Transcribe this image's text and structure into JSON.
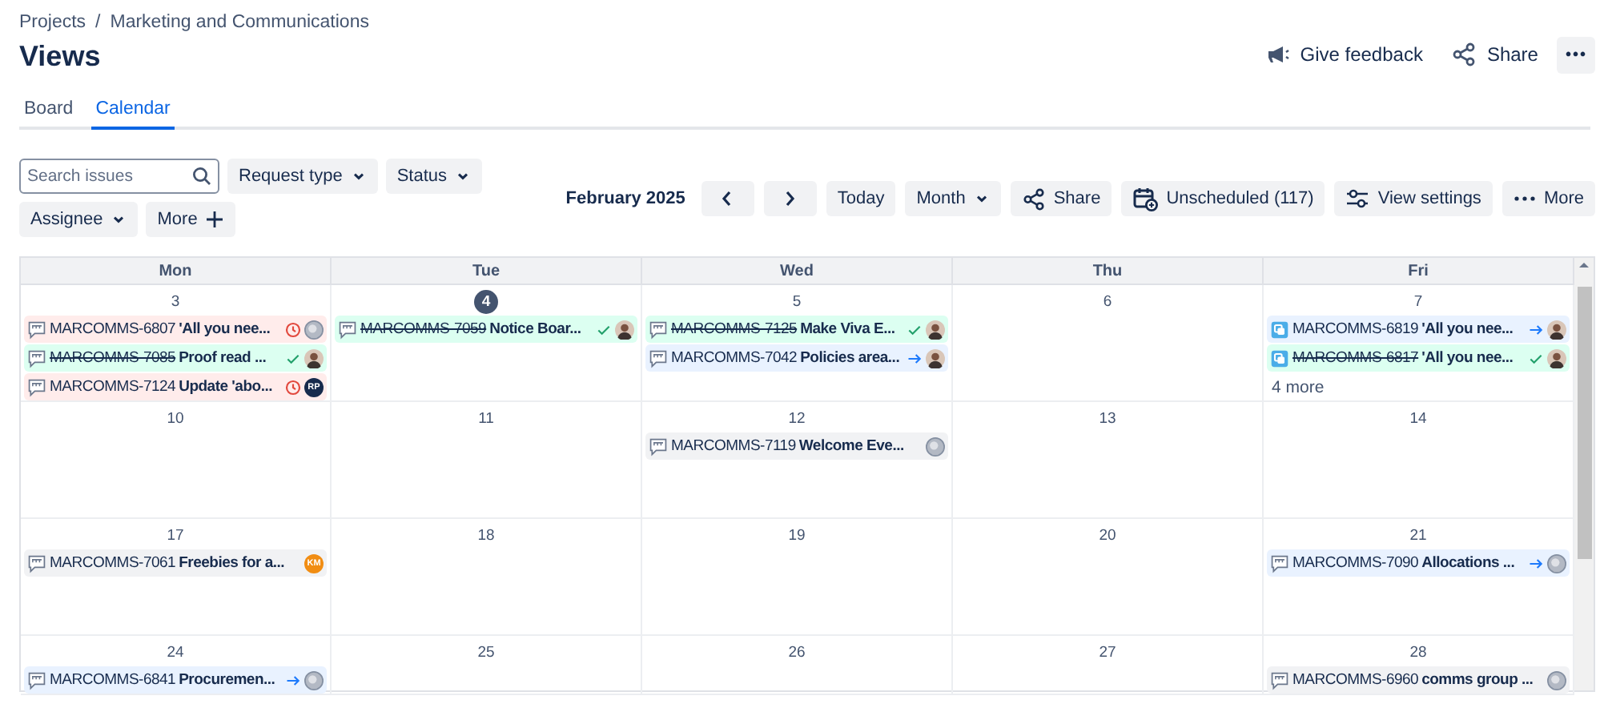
{
  "breadcrumbs": [
    {
      "label": "Projects",
      "separator": "/"
    },
    {
      "label": "Marketing and Communications"
    }
  ],
  "title": "Views",
  "header_actions": [
    {
      "kind": "feedback",
      "label": "Give feedback"
    },
    {
      "kind": "share",
      "label": "Share"
    },
    {
      "kind": "more",
      "label": "•••"
    }
  ],
  "tabs": [
    {
      "label": "Board",
      "selected": false
    },
    {
      "label": "Calendar",
      "selected": true
    }
  ],
  "search": {
    "placeholder": "Search issues"
  },
  "filters": [
    {
      "label": "Request type"
    },
    {
      "label": "Status"
    },
    {
      "label": "Assignee"
    }
  ],
  "more_filters": {
    "label": "More"
  },
  "toolbar": {
    "month_label": "February 2025",
    "buttons": [
      {
        "kind": "prev"
      },
      {
        "kind": "next"
      },
      {
        "kind": "plain",
        "label": "Today"
      },
      {
        "kind": "dropdown",
        "label": "Month"
      },
      {
        "kind": "share",
        "label": "Share"
      },
      {
        "kind": "unscheduled",
        "label": "Unscheduled (117)"
      },
      {
        "kind": "settings",
        "label": "View settings"
      },
      {
        "kind": "more",
        "label": "More"
      }
    ]
  },
  "calendar": {
    "weekdays": [
      "Mon",
      "Tue",
      "Wed",
      "Thu",
      "Fri"
    ],
    "weeks": [
      {
        "days": [
          {
            "date": "3",
            "today": false,
            "issues": [
              {
                "issue_type": {
                  "kind": "chat"
                },
                "key": "MARCOMMS-6807",
                "resolved": false,
                "title": "'All you nee...",
                "status": {
                  "kind": "overdue"
                },
                "avatar": {
                  "kind": "default"
                }
              },
              {
                "issue_type": {
                  "kind": "chat"
                },
                "key": "MARCOMMS-7085",
                "resolved": true,
                "title": "Proof read ...",
                "status": {
                  "kind": "done"
                },
                "avatar": {
                  "kind": "photo"
                }
              },
              {
                "issue_type": {
                  "kind": "chat"
                },
                "key": "MARCOMMS-7124",
                "resolved": false,
                "title": "Update 'abo...",
                "status": {
                  "kind": "overdue"
                },
                "avatar": {
                  "kind": "initials",
                  "initials": "RP",
                  "color": "#172b4d"
                }
              }
            ]
          },
          {
            "date": "4",
            "today": true,
            "issues": [
              {
                "issue_type": {
                  "kind": "chat"
                },
                "key": "MARCOMMS-7059",
                "resolved": true,
                "title": "Notice Boar...",
                "status": {
                  "kind": "done"
                },
                "avatar": {
                  "kind": "photo"
                }
              }
            ]
          },
          {
            "date": "5",
            "today": false,
            "issues": [
              {
                "issue_type": {
                  "kind": "chat"
                },
                "key": "MARCOMMS-7125",
                "resolved": true,
                "title": "Make Viva E...",
                "status": {
                  "kind": "done"
                },
                "avatar": {
                  "kind": "photo"
                }
              },
              {
                "issue_type": {
                  "kind": "chat"
                },
                "key": "MARCOMMS-7042",
                "resolved": false,
                "title": "Policies area...",
                "status": {
                  "kind": "in_progress"
                },
                "avatar": {
                  "kind": "photo"
                }
              }
            ]
          },
          {
            "date": "6",
            "today": false
          },
          {
            "date": "7",
            "today": false,
            "issues": [
              {
                "issue_type": {
                  "kind": "task"
                },
                "key": "MARCOMMS-6819",
                "resolved": false,
                "title": "'All you nee...",
                "status": {
                  "kind": "in_progress"
                },
                "avatar": {
                  "kind": "photo"
                }
              },
              {
                "issue_type": {
                  "kind": "task"
                },
                "key": "MARCOMMS-6817",
                "resolved": true,
                "title": "'All you nee...",
                "status": {
                  "kind": "done"
                },
                "avatar": {
                  "kind": "photo"
                }
              }
            ],
            "more": "4 more"
          }
        ]
      },
      {
        "days": [
          {
            "date": "10",
            "today": false
          },
          {
            "date": "11",
            "today": false
          },
          {
            "date": "12",
            "today": false,
            "issues": [
              {
                "issue_type": {
                  "kind": "chat"
                },
                "key": "MARCOMMS-7119",
                "resolved": false,
                "title": "Welcome Eve...",
                "status": {
                  "kind": "open"
                },
                "avatar": {
                  "kind": "default"
                }
              }
            ]
          },
          {
            "date": "13",
            "today": false
          },
          {
            "date": "14",
            "today": false
          }
        ]
      },
      {
        "days": [
          {
            "date": "17",
            "today": false,
            "issues": [
              {
                "issue_type": {
                  "kind": "chat"
                },
                "key": "MARCOMMS-7061",
                "resolved": false,
                "title": "Freebies for a...",
                "status": {
                  "kind": "open"
                },
                "avatar": {
                  "kind": "initials",
                  "initials": "KM",
                  "color": "#f18d13"
                }
              }
            ]
          },
          {
            "date": "18",
            "today": false
          },
          {
            "date": "19",
            "today": false
          },
          {
            "date": "20",
            "today": false
          },
          {
            "date": "21",
            "today": false,
            "issues": [
              {
                "issue_type": {
                  "kind": "chat"
                },
                "key": "MARCOMMS-7090",
                "resolved": false,
                "title": "Allocations ...",
                "status": {
                  "kind": "in_progress"
                },
                "avatar": {
                  "kind": "default"
                }
              }
            ]
          }
        ]
      },
      {
        "days": [
          {
            "date": "24",
            "today": false,
            "issues": [
              {
                "issue_type": {
                  "kind": "chat"
                },
                "key": "MARCOMMS-6841",
                "resolved": false,
                "title": "Procuremen...",
                "status": {
                  "kind": "in_progress"
                },
                "avatar": {
                  "kind": "default"
                }
              }
            ]
          },
          {
            "date": "25",
            "today": false
          },
          {
            "date": "26",
            "today": false
          },
          {
            "date": "27",
            "today": false
          },
          {
            "date": "28",
            "today": false,
            "issues": [
              {
                "issue_type": {
                  "kind": "chat"
                },
                "key": "MARCOMMS-6960",
                "resolved": false,
                "title": "comms group ...",
                "status": {
                  "kind": "open"
                },
                "avatar": {
                  "kind": "default"
                }
              }
            ]
          }
        ]
      }
    ]
  }
}
